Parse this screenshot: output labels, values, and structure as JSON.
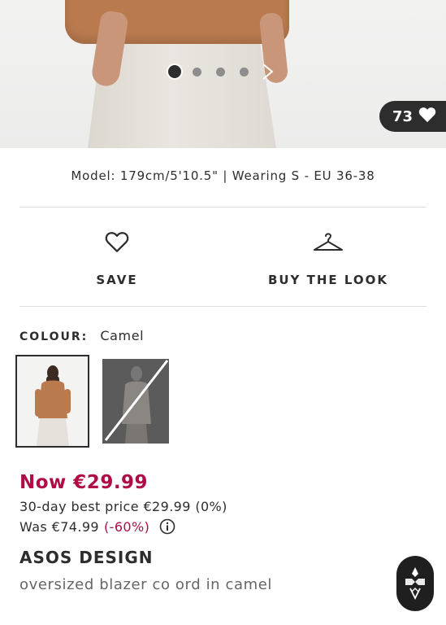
{
  "gallery": {
    "image_count": 4,
    "active_index": 0,
    "likes": "73",
    "icons": {
      "like": "heart-filled-icon",
      "next": "chevron-right-icon"
    }
  },
  "model_info": "Model: 179cm/5'10.5\" | Wearing S - EU 36-38",
  "actions": {
    "save_label": "SAVE",
    "buy_the_look_label": "BUY THE LOOK",
    "icons": {
      "save": "heart-outline-icon",
      "buy_the_look": "hanger-icon"
    }
  },
  "colour": {
    "label": "COLOUR:",
    "value": "Camel",
    "swatches": [
      {
        "selected": true
      },
      {
        "selected": false,
        "unavailable": true
      }
    ]
  },
  "price": {
    "now": "Now €29.99",
    "best_price": "30-day best price €29.99 (0%)",
    "was": "Was €74.99",
    "discount": "(-60%)",
    "info_icon": "info-circle-icon"
  },
  "product": {
    "brand": "ASOS DESIGN",
    "name": "oversized blazer co ord in camel"
  },
  "colors": {
    "text": "#2d2d2d",
    "sale_red": "#b00b46",
    "divider": "#dddddd",
    "muted": "#666666"
  }
}
